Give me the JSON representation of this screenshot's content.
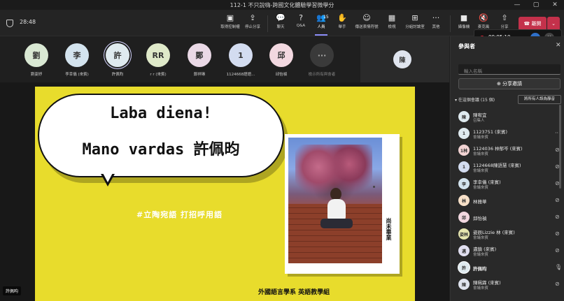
{
  "window": {
    "title": "112-1 不只說嗨-跨國文化體驗學習微學分",
    "controls": [
      "—",
      "▢",
      "✕"
    ]
  },
  "toolbar": {
    "elapsed": "28:48",
    "items": [
      {
        "name": "take-control",
        "icon": "▣",
        "label": "取得控制權"
      },
      {
        "name": "stop-share",
        "icon": "⇪",
        "label": "停止分享"
      },
      {
        "name": "chat",
        "icon": "💬",
        "label": "聊天"
      },
      {
        "name": "qa",
        "icon": "?",
        "label": "Q&A"
      },
      {
        "name": "people",
        "icon": "👥",
        "label": "人員",
        "badge": "15"
      },
      {
        "name": "raise-hand",
        "icon": "✋",
        "label": "舉手"
      },
      {
        "name": "reactions",
        "icon": "☺",
        "label": "傳送表情符號"
      },
      {
        "name": "view",
        "icon": "▦",
        "label": "檢視"
      },
      {
        "name": "rooms",
        "icon": "⊞",
        "label": "分組討論室"
      },
      {
        "name": "more",
        "icon": "···",
        "label": "其他"
      },
      {
        "name": "camera",
        "icon": "■",
        "label": "攝像機"
      },
      {
        "name": "mic",
        "icon": "🔇",
        "label": "麥克風"
      },
      {
        "name": "share",
        "icon": "⇧",
        "label": "分享"
      }
    ],
    "leave_label": "離開"
  },
  "recording": {
    "time": "00:05:10"
  },
  "participants_strip": [
    {
      "initial": "劉",
      "name": "劉姿妤",
      "color": "#d9e8d3"
    },
    {
      "initial": "李",
      "name": "李幸儀 (來賓)",
      "color": "#d3e3ee"
    },
    {
      "initial": "許",
      "name": "許佩昀",
      "color": "#dfeaef",
      "selected": true
    },
    {
      "initial": "RR",
      "name": "r r (來賓)",
      "color": "#dfe9c9"
    },
    {
      "initial": "鄭",
      "name": "鄭祥琳",
      "color": "#ead9e6"
    },
    {
      "initial": "1",
      "name": "1124668語語...",
      "color": "#d3dcf0"
    },
    {
      "initial": "邱",
      "name": "邱怡禎",
      "color": "#f2d8e0"
    }
  ],
  "strip_more_label": "檢示所有與會者",
  "pinned_initial": "陳",
  "slide": {
    "line1": "Laba diena!",
    "line2": "Mano vardas 許佩昀",
    "hashtag": "#立陶宛語 打招呼用語",
    "spine_text": "尚未畢業",
    "caption": "外國語言學系 英語教學組"
  },
  "presenter_name": "許佩昀",
  "panel": {
    "title": "參與者",
    "search_placeholder": "輸入名稱",
    "share_invite": "分享邀請",
    "section": "在這個會議 (15 個)",
    "mute_all": "將所有人設為靜音",
    "people": [
      {
        "initial": "陳",
        "name": "陳宥宜",
        "role": "召集人",
        "color": "#dfeaef"
      },
      {
        "initial": "1",
        "name": "1123751 (來賓)",
        "role": "會議來賓",
        "color": "#dfeaef"
      },
      {
        "initial": "1林",
        "name": "1124036 林郁岑 (來賓)",
        "role": "會議來賓",
        "color": "#f2d3d3"
      },
      {
        "initial": "1",
        "name": "1124668陳語慧 (來賓)",
        "role": "會議來賓",
        "color": "#d3dcf0"
      },
      {
        "initial": "李",
        "name": "李幸儀 (來賓)",
        "role": "會議來賓",
        "color": "#d3e3ee"
      },
      {
        "initial": "林",
        "name": "林雅華",
        "role": "",
        "color": "#f7e0c8"
      },
      {
        "initial": "邱",
        "name": "邱怡禎",
        "role": "",
        "color": "#f2d8e0"
      },
      {
        "initial": "姿林",
        "name": "姿辰Lizzie 林 (來賓)",
        "role": "會議來賓",
        "color": "#e6e6b0"
      },
      {
        "initial": "邁",
        "name": "邁鎮 (來賓)",
        "role": "會議來賓",
        "color": "#e1dff0"
      },
      {
        "initial": "許",
        "name": "許佩昀",
        "role": "",
        "color": "#dfeaef"
      },
      {
        "initial": "陳",
        "name": "陳珮霖 (來賓)",
        "role": "會議來賓",
        "color": "#dfe4ee"
      }
    ]
  }
}
